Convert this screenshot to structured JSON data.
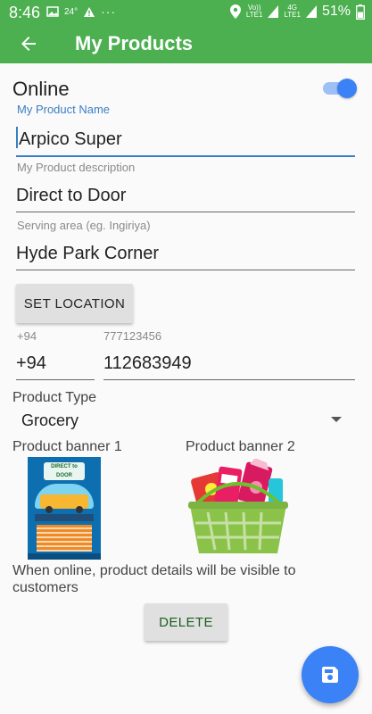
{
  "status_bar": {
    "time": "8:46",
    "temperature": "24°",
    "network_left": "Vo))",
    "network_left_sub": "LTE1",
    "network_right": "4G",
    "network_right_sub": "LTE1",
    "battery": "51%",
    "icons": [
      "image-icon",
      "warning-icon",
      "more-dots-icon",
      "location-pin-icon",
      "signal-icon",
      "battery-icon"
    ]
  },
  "appbar": {
    "title": "My Products",
    "back_icon": "arrow-left-icon",
    "color": "#4caf50"
  },
  "online": {
    "label": "Online",
    "enabled": true,
    "accent": "#3b82f6"
  },
  "form": {
    "name": {
      "label": "My Product Name",
      "value": "Arpico Super"
    },
    "description": {
      "label": "My Product description",
      "value": "Direct to Door"
    },
    "serving_area": {
      "label": "Serving area (eg. Ingiriya)",
      "value": "Hyde Park Corner"
    },
    "set_location_label": "SET LOCATION",
    "country_code": {
      "placeholder": "+94",
      "value": "+94"
    },
    "phone": {
      "placeholder": "777123456",
      "value": "112683949"
    }
  },
  "product_type": {
    "label": "Product Type",
    "selected": "Grocery"
  },
  "banners": {
    "banner1_label": "Product banner 1",
    "banner2_label": "Product banner 2",
    "banner1_text": "DIRECT to DOOR"
  },
  "note": "When online, product details will be visible to customers",
  "delete_label": "DELETE",
  "fab_icon": "save-icon"
}
